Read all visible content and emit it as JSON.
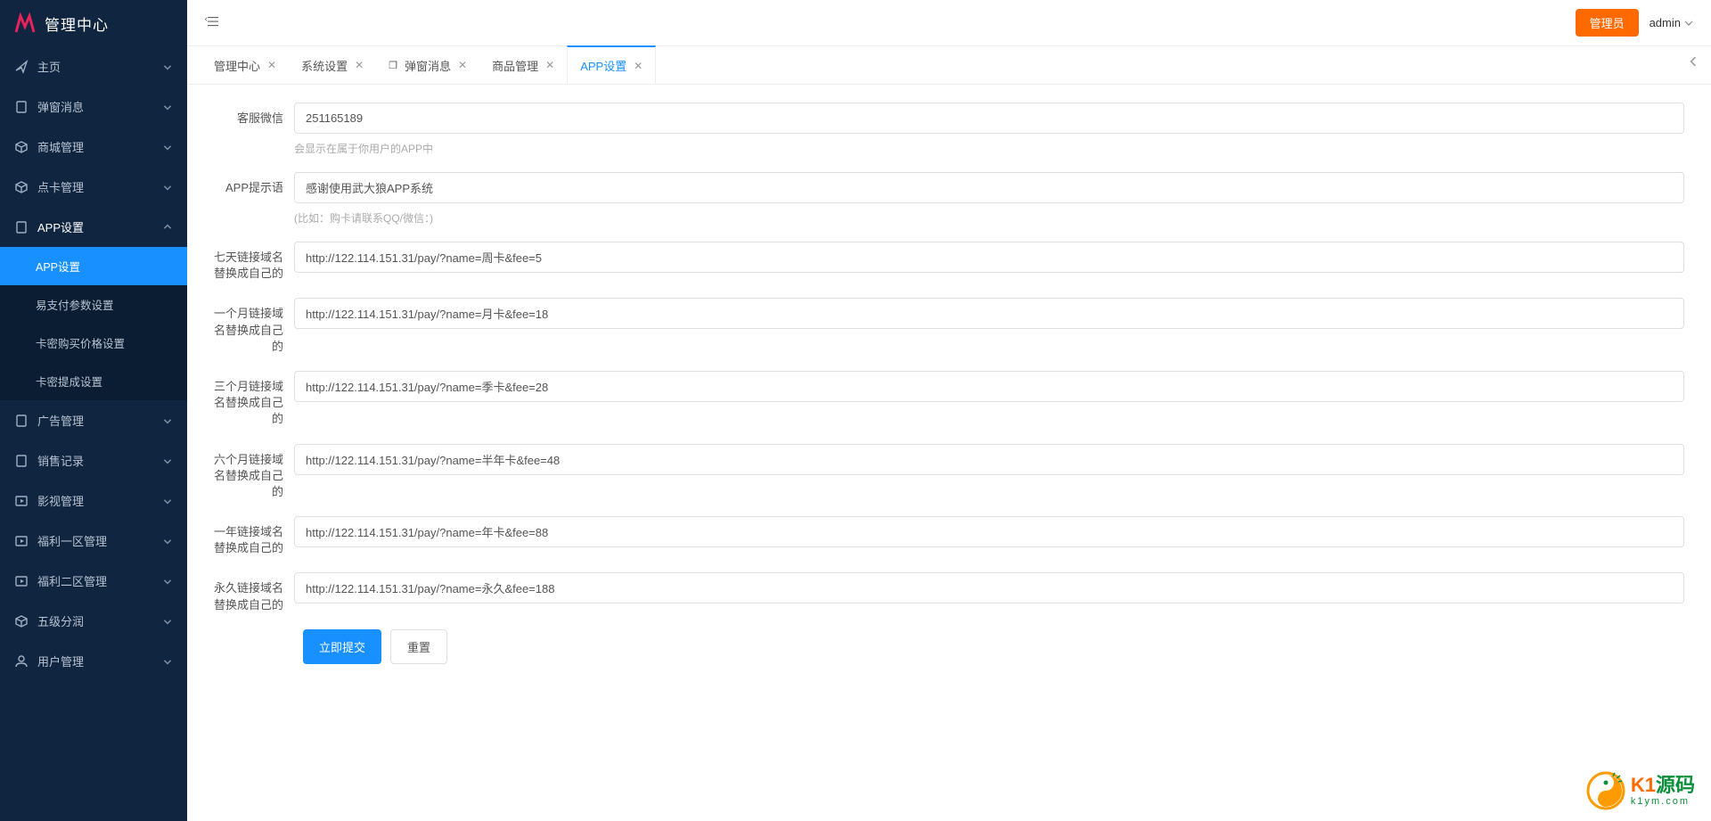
{
  "brand": {
    "title": "管理中心"
  },
  "header": {
    "admin_badge": "管理员",
    "user": "admin"
  },
  "sidebar": {
    "items": [
      {
        "icon": "send",
        "label": "主页",
        "kind": "parent"
      },
      {
        "icon": "device",
        "label": "弹窗消息",
        "kind": "parent"
      },
      {
        "icon": "cube",
        "label": "商城管理",
        "kind": "parent"
      },
      {
        "icon": "cube",
        "label": "点卡管理",
        "kind": "parent"
      },
      {
        "icon": "device",
        "label": "APP设置",
        "kind": "parent",
        "expanded": true,
        "children": [
          {
            "label": "APP设置",
            "active": true
          },
          {
            "label": "易支付参数设置"
          },
          {
            "label": "卡密购买价格设置"
          },
          {
            "label": "卡密提成设置"
          }
        ]
      },
      {
        "icon": "device",
        "label": "广告管理",
        "kind": "parent"
      },
      {
        "icon": "device",
        "label": "销售记录",
        "kind": "parent"
      },
      {
        "icon": "play",
        "label": "影视管理",
        "kind": "parent"
      },
      {
        "icon": "play",
        "label": "福利一区管理",
        "kind": "parent"
      },
      {
        "icon": "play",
        "label": "福利二区管理",
        "kind": "parent"
      },
      {
        "icon": "cube",
        "label": "五级分润",
        "kind": "parent"
      },
      {
        "icon": "user",
        "label": "用户管理",
        "kind": "parent"
      }
    ]
  },
  "tabs": [
    {
      "label": "管理中心",
      "closable": true
    },
    {
      "label": "系统设置",
      "closable": true
    },
    {
      "label": "弹窗消息",
      "closable": true,
      "prefix": "❐"
    },
    {
      "label": "商品管理",
      "closable": true
    },
    {
      "label": "APP设置",
      "closable": true,
      "active": true
    }
  ],
  "form": {
    "fields": [
      {
        "label": "客服微信",
        "value": "251165189",
        "hint": "会显示在属于你用户的APP中"
      },
      {
        "label": "APP提示语",
        "value": "感谢使用武大狼APP系统",
        "hint": "(比如：购卡请联系QQ/微信：)"
      },
      {
        "label": "七天链接域名替换成自己的",
        "value": "http://122.114.151.31/pay/?name=周卡&fee=5"
      },
      {
        "label": "一个月链接域名替换成自己的",
        "value": "http://122.114.151.31/pay/?name=月卡&fee=18"
      },
      {
        "label": "三个月链接域名替换成自己的",
        "value": "http://122.114.151.31/pay/?name=季卡&fee=28"
      },
      {
        "label": "六个月链接域名替换成自己的",
        "value": "http://122.114.151.31/pay/?name=半年卡&fee=48"
      },
      {
        "label": "一年链接域名替换成自己的",
        "value": "http://122.114.151.31/pay/?name=年卡&fee=88"
      },
      {
        "label": "永久链接域名替换成自己的",
        "value": "http://122.114.151.31/pay/?name=永久&fee=188"
      }
    ],
    "submit": "立即提交",
    "reset": "重置"
  },
  "watermark": {
    "brand1": "K1",
    "brand2": "源码",
    "url": "k1ym.com"
  }
}
